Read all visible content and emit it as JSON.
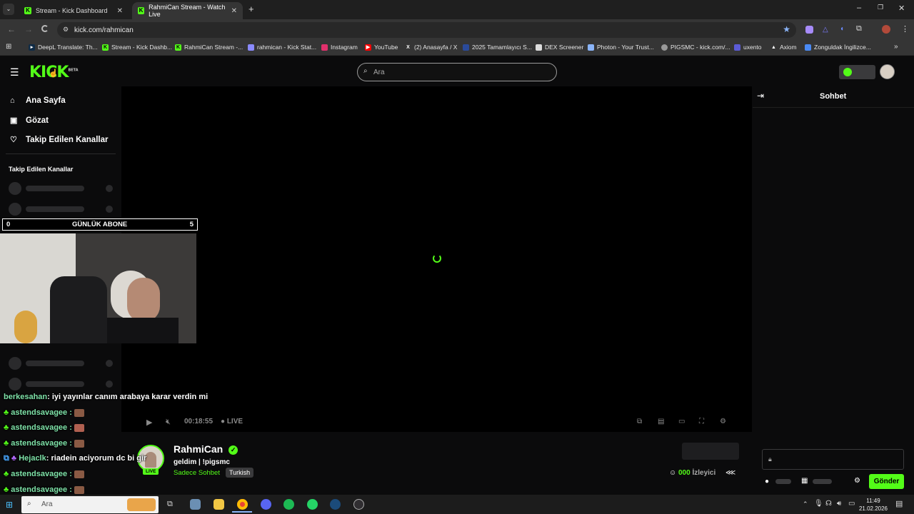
{
  "browser": {
    "tabs": [
      {
        "title": "Stream - Kick Dashboard"
      },
      {
        "title": "RahmiCan Stream - Watch Live"
      }
    ],
    "url": "kick.com/rahmican",
    "bookmarks": [
      "DeepL Translate: Th...",
      "Stream - Kick Dashb...",
      "RahmiCan Stream -...",
      "rahmican - Kick Stat...",
      "Instagram",
      "YouTube",
      "(2) Anasayfa / X",
      "2025 Tamamlayıcı S...",
      "DEX Screener",
      "Photon - Your Trust...",
      "PIGSMC - kick.com/...",
      "uxento",
      "Axiom",
      "Zonguldak İngilizce..."
    ]
  },
  "header": {
    "logo": "KICK",
    "logo_tag": "BETA",
    "search_placeholder": "Ara"
  },
  "sidebar": {
    "nav": [
      "Ana Sayfa",
      "Gözat",
      "Takip Edilen Kanallar"
    ],
    "followed_title": "Takip Edilen Kanallar"
  },
  "overlay": {
    "sub_left": "0",
    "sub_title": "GÜNLÜK ABONE",
    "sub_right": "5"
  },
  "chat_overlay": [
    {
      "user": "berkesahan",
      "text": ": iyi yayınlar canım arabaya karar verdin mi",
      "emote": false
    },
    {
      "user": "astendsavagee :",
      "text": "",
      "emote": true
    },
    {
      "user": "astendsavagee :",
      "text": "",
      "emote": true
    },
    {
      "user": "astendsavagee :",
      "text": "",
      "emote": true
    },
    {
      "user": "Hejaclk",
      "text": ": riadein aciyorum dc bi gir",
      "emote": false
    },
    {
      "user": "astendsavagee :",
      "text": "",
      "emote": true
    },
    {
      "user": "astendsavagee :",
      "text": "",
      "emote": true
    }
  ],
  "player": {
    "time": "00:18:55",
    "live_label": "LIVE"
  },
  "stream": {
    "name": "RahmiCan",
    "title": "geldim | !pigsmc",
    "mode": "Sadece Sohbet",
    "language": "Turkish",
    "live_badge": "LIVE",
    "viewers_count": "000",
    "viewers_label": "İzleyici"
  },
  "chat": {
    "title": "Sohbet",
    "send_label": "Gönder"
  },
  "taskbar": {
    "search_text": "Ara",
    "time": "11:49",
    "date": "21.02.2026"
  },
  "colors": {
    "accent": "#53fc18",
    "background": "#0b0b0c"
  }
}
